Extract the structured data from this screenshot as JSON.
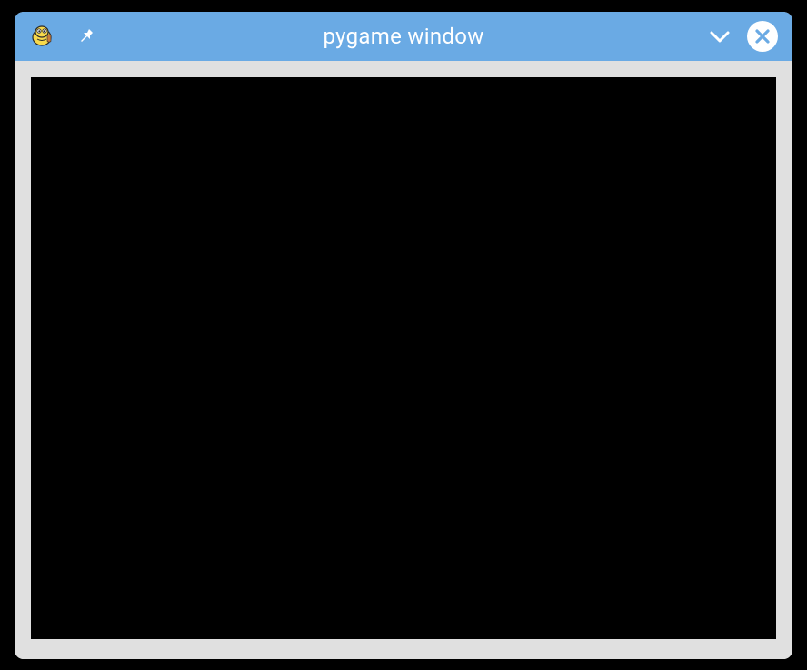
{
  "window": {
    "title": "pygame window"
  },
  "colors": {
    "titlebar": "#6aaae4",
    "titlebar_text": "#ffffff",
    "window_chrome": "#e0e0e0",
    "content_bg": "#000000"
  },
  "icons": {
    "app": "pygame-snake-icon",
    "pin": "pin-icon",
    "minimize": "chevron-down-icon",
    "close": "close-icon"
  }
}
